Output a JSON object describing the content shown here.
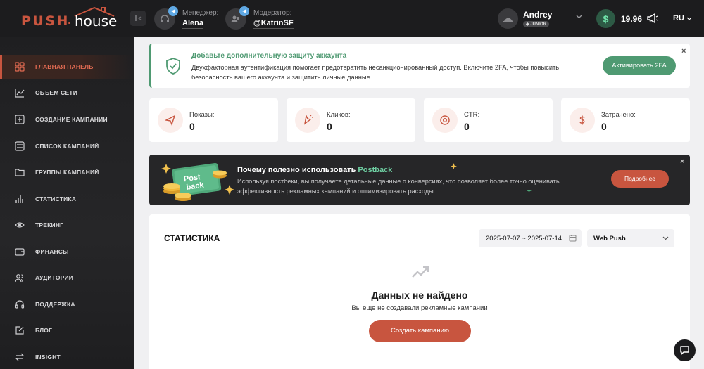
{
  "logo": {
    "part1": "PUSH",
    "dot": ".",
    "part2": "house"
  },
  "header": {
    "manager": {
      "label": "Менеджер:",
      "name": "Alena"
    },
    "moderator": {
      "label": "Модератор:",
      "name": "@KatrinSF"
    },
    "user": {
      "name": "Andrey",
      "level": "JUNIOR"
    },
    "balance": {
      "symbol": "$",
      "amount": "19.96"
    },
    "language": "RU"
  },
  "sidebar": {
    "items": [
      {
        "label": "ГЛАВНАЯ ПАНЕЛЬ",
        "icon": "grid-icon",
        "active": true
      },
      {
        "label": "ОБЪЕМ СЕТИ",
        "icon": "chart-line-icon"
      },
      {
        "label": "СОЗДАНИЕ КАМПАНИИ",
        "icon": "plus-square-icon"
      },
      {
        "label": "СПИСОК КАМПАНИЙ",
        "icon": "list-icon"
      },
      {
        "label": "ГРУППЫ КАМПАНИЙ",
        "icon": "folder-icon"
      },
      {
        "label": "СТАТИСТИКА",
        "icon": "bar-chart-icon"
      },
      {
        "label": "ТРЕКИНГ",
        "icon": "eye-icon"
      },
      {
        "label": "ФИНАНСЫ",
        "icon": "wallet-icon"
      },
      {
        "label": "АУДИТОРИИ",
        "icon": "users-icon"
      },
      {
        "label": "ПОДДЕРЖКА",
        "icon": "headset-icon"
      },
      {
        "label": "БЛОГ",
        "icon": "edit-icon"
      },
      {
        "label": "INSIGHT",
        "icon": "swap-icon"
      }
    ]
  },
  "alert": {
    "title": "Добавьте дополнительную защиту аккаунта",
    "description": "Двухфакторная аутентификация помогает предотвратить несанкционированный доступ. Включите 2FA, чтобы повысить безопасность вашего аккаунта и защитить личные данные.",
    "button": "Активировать 2FA",
    "close": "×"
  },
  "stats": [
    {
      "label": "Показы:",
      "value": "0",
      "icon": "send-icon"
    },
    {
      "label": "Кликов:",
      "value": "0",
      "icon": "cursor-click-icon"
    },
    {
      "label": "CTR:",
      "value": "0",
      "icon": "target-icon"
    },
    {
      "label": "Затрачено:",
      "value": "0",
      "icon": "dollar-icon"
    }
  ],
  "promo": {
    "badge_line1": "Post",
    "badge_line2": "back",
    "title_prefix": "Почему полезно использовать ",
    "title_accent": "Postback",
    "description": "Используя постбеки, вы получаете детальные данные о конверсиях, что позволяет более точно оценивать эффективность рекламных кампаний и оптимизировать расходы",
    "button": "Подробнее",
    "close": "×"
  },
  "statistics": {
    "title": "СТАТИСТИКА",
    "date_range": "2025-07-07 ~ 2025-07-14",
    "type": "Web Push",
    "empty_title": "Данных не найдено",
    "empty_description": "Вы еще не создавали рекламные кампании",
    "create_button": "Создать кампанию"
  },
  "colors": {
    "accent": "#c8553f",
    "success": "#4f9a72",
    "dark": "#1c1c1e"
  }
}
